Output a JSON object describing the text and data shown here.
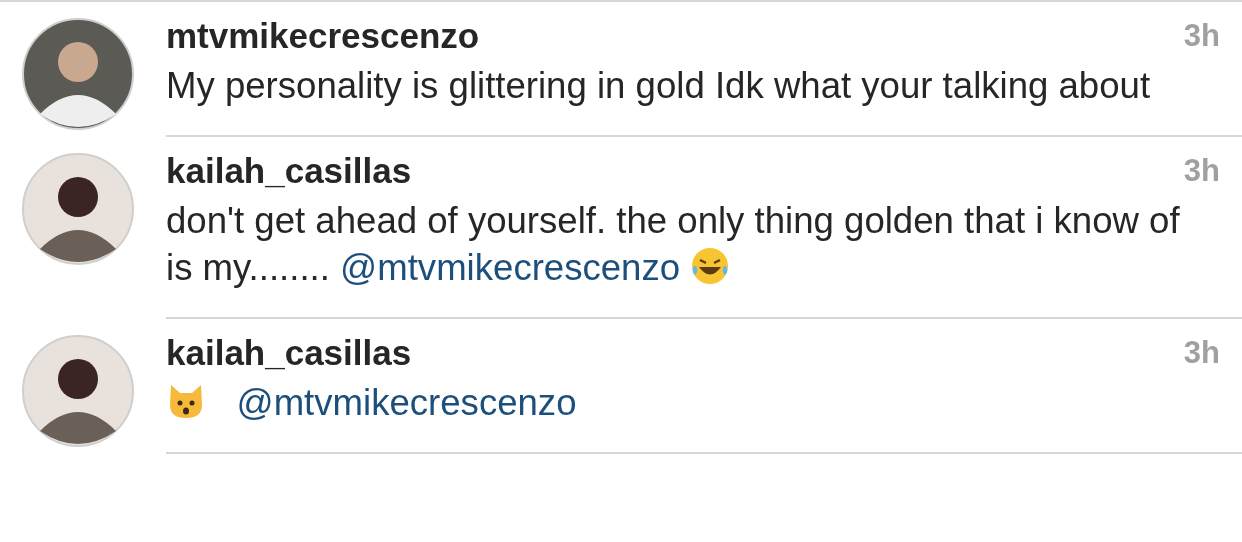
{
  "comments": [
    {
      "username": "mtvmikecrescenzo",
      "time": "3h",
      "parts": [
        {
          "kind": "text",
          "text": "My personality is glittering in gold Idk what your talking about"
        }
      ]
    },
    {
      "username": "kailah_casillas",
      "time": "3h",
      "parts": [
        {
          "kind": "text",
          "text": "don't get ahead of yourself. the only thing golden that i know of is my........ "
        },
        {
          "kind": "mention",
          "text": "@mtvmikecrescenzo"
        },
        {
          "kind": "laugh-emoji"
        }
      ]
    },
    {
      "username": "kailah_casillas",
      "time": "3h",
      "parts": [
        {
          "kind": "cat-emoji"
        },
        {
          "kind": "mention",
          "text": "@mtvmikecrescenzo"
        }
      ]
    }
  ]
}
